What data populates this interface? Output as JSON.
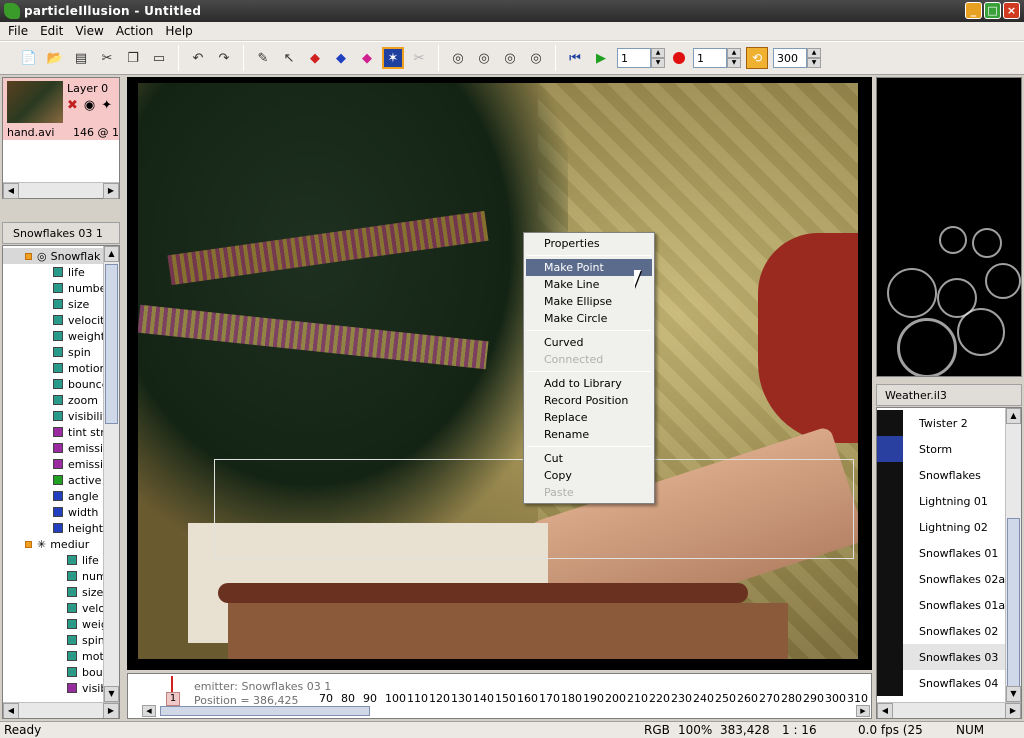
{
  "titlebar": {
    "title": "particleIllusion - Untitled"
  },
  "menu": {
    "items": [
      "File",
      "Edit",
      "View",
      "Action",
      "Help"
    ]
  },
  "toolbar": {
    "frame_start": "1",
    "frame_current": "1",
    "frame_end": "300"
  },
  "layer": {
    "name": "Layer 0",
    "file": "hand.avi",
    "frames": "146 @ 1"
  },
  "emitter_panel": {
    "header": "Snowflakes 03 1",
    "items": [
      {
        "label": "Snowflak",
        "kind": "emitter",
        "indent": 0
      },
      {
        "label": "life",
        "kind": "teal",
        "indent": 1
      },
      {
        "label": "numbe",
        "kind": "teal",
        "indent": 1
      },
      {
        "label": "size",
        "kind": "teal",
        "indent": 1
      },
      {
        "label": "velocit",
        "kind": "teal",
        "indent": 1
      },
      {
        "label": "weight",
        "kind": "teal",
        "indent": 1
      },
      {
        "label": "spin",
        "kind": "teal",
        "indent": 1
      },
      {
        "label": "motion",
        "kind": "teal",
        "indent": 1
      },
      {
        "label": "bounce",
        "kind": "teal",
        "indent": 1
      },
      {
        "label": "zoom",
        "kind": "teal",
        "indent": 1
      },
      {
        "label": "visibilit",
        "kind": "teal",
        "indent": 1
      },
      {
        "label": "tint str",
        "kind": "purple",
        "indent": 1
      },
      {
        "label": "emissi",
        "kind": "purple",
        "indent": 1
      },
      {
        "label": "emissi",
        "kind": "purple",
        "indent": 1
      },
      {
        "label": "active",
        "kind": "green",
        "indent": 1
      },
      {
        "label": "angle",
        "kind": "blue",
        "indent": 1
      },
      {
        "label": "width",
        "kind": "blue",
        "indent": 1
      },
      {
        "label": "height",
        "kind": "blue",
        "indent": 1
      },
      {
        "label": "mediur",
        "kind": "particle",
        "indent": 0
      },
      {
        "label": "life",
        "kind": "teal",
        "indent": 2
      },
      {
        "label": "num",
        "kind": "teal",
        "indent": 2
      },
      {
        "label": "size",
        "kind": "teal",
        "indent": 2
      },
      {
        "label": "velo",
        "kind": "teal",
        "indent": 2
      },
      {
        "label": "weig",
        "kind": "teal",
        "indent": 2
      },
      {
        "label": "spin",
        "kind": "teal",
        "indent": 2
      },
      {
        "label": "mot",
        "kind": "teal",
        "indent": 2
      },
      {
        "label": "bou",
        "kind": "teal",
        "indent": 2
      },
      {
        "label": "visib",
        "kind": "purple",
        "indent": 2
      }
    ]
  },
  "context_menu": {
    "groups": [
      [
        {
          "label": "Properties",
          "state": "normal"
        }
      ],
      [
        {
          "label": "Make Point",
          "state": "highlight"
        },
        {
          "label": "Make Line",
          "state": "normal"
        },
        {
          "label": "Make Ellipse",
          "state": "normal"
        },
        {
          "label": "Make Circle",
          "state": "normal"
        }
      ],
      [
        {
          "label": "Curved",
          "state": "normal"
        },
        {
          "label": "Connected",
          "state": "disabled"
        }
      ],
      [
        {
          "label": "Add to Library",
          "state": "normal"
        },
        {
          "label": "Record Position",
          "state": "normal"
        },
        {
          "label": "Replace",
          "state": "normal"
        },
        {
          "label": "Rename",
          "state": "normal"
        }
      ],
      [
        {
          "label": "Cut",
          "state": "normal"
        },
        {
          "label": "Copy",
          "state": "normal"
        },
        {
          "label": "Paste",
          "state": "disabled"
        }
      ]
    ]
  },
  "library": {
    "header": "Weather.il3",
    "items": [
      {
        "label": "Twister 2",
        "selected": false
      },
      {
        "label": "Storm",
        "selected": false
      },
      {
        "label": "Snowflakes",
        "selected": false
      },
      {
        "label": "Lightning 01",
        "selected": false
      },
      {
        "label": "Lightning 02",
        "selected": false
      },
      {
        "label": "Snowflakes 01",
        "selected": false
      },
      {
        "label": "Snowflakes 02a",
        "selected": false
      },
      {
        "label": "Snowflakes 01a",
        "selected": false
      },
      {
        "label": "Snowflakes 02",
        "selected": false
      },
      {
        "label": "Snowflakes 03",
        "selected": true
      },
      {
        "label": "Snowflakes 04",
        "selected": false
      }
    ]
  },
  "timeline": {
    "frame_marker": "1",
    "emitter_info": "emitter: Snowflakes 03 1",
    "position_info": "Position = 386,425",
    "ticks": [
      "70",
      "80",
      "90",
      "100",
      "110",
      "120",
      "130",
      "140",
      "150",
      "160",
      "170",
      "180",
      "190",
      "200",
      "210",
      "220",
      "230",
      "240",
      "250",
      "260",
      "270",
      "280",
      "290",
      "300",
      "310"
    ]
  },
  "status": {
    "left": "Ready",
    "mode": "RGB",
    "zoom": "100%",
    "coords": "383,428",
    "ratio": "1 : 16",
    "fps": "0.0 fps (25",
    "num": "NUM"
  },
  "colors": {
    "teal": "#2a9a8a",
    "purple": "#9a2aa0",
    "green": "#20a020",
    "blue": "#2040c0",
    "highlight": "#5a6b8c"
  }
}
